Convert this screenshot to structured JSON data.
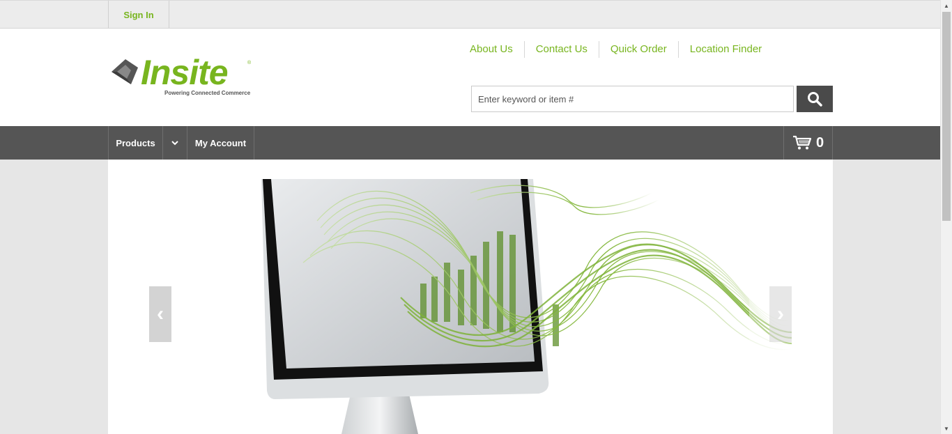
{
  "topbar": {
    "sign_in": "Sign In"
  },
  "logo": {
    "word": "Insite",
    "registered": "®",
    "tagline": "Powering Connected Commerce"
  },
  "utility_links": [
    "About Us",
    "Contact Us",
    "Quick Order",
    "Location Finder"
  ],
  "search": {
    "placeholder": "Enter keyword or item #",
    "value": ""
  },
  "nav": {
    "products": "Products",
    "my_account": "My Account"
  },
  "cart": {
    "count": "0"
  },
  "carousel": {
    "prev": "‹",
    "next": "›"
  },
  "colors": {
    "accent": "#78b51f",
    "nav": "#555555",
    "search_button": "#4a4a4a"
  }
}
